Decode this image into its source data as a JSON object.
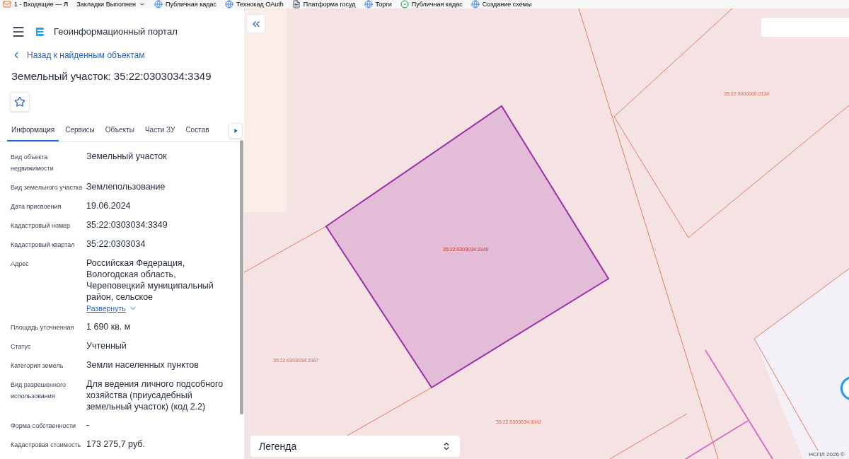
{
  "bookmarks": [
    {
      "kind": "mail",
      "label": "1 - Входящие — Я"
    },
    {
      "kind": "folder",
      "label": "Закладки Выполнен"
    },
    {
      "kind": "site",
      "label": "Публичная кадас"
    },
    {
      "kind": "site",
      "label": "Технокад OAuth"
    },
    {
      "kind": "page",
      "label": "Платформа госуд"
    },
    {
      "kind": "site",
      "label": "Торги"
    },
    {
      "kind": "check",
      "label": "Публичная кадас"
    },
    {
      "kind": "site",
      "label": "Создание схемы"
    }
  ],
  "header": {
    "title": "Геоинформационный портал"
  },
  "back_link": "Назад к найденным объектам",
  "object_title": "Земельный участок: 35:22:0303034:3349",
  "tabs": [
    {
      "label": "Информация",
      "selected": true
    },
    {
      "label": "Сервисы",
      "selected": false
    },
    {
      "label": "Объекты",
      "selected": false
    },
    {
      "label": "Части ЗУ",
      "selected": false
    },
    {
      "label": "Состав",
      "selected": false
    }
  ],
  "fields": [
    {
      "label": "Вид объекта недвижимости",
      "value": "Земельный участок"
    },
    {
      "label": "Вид земельного участка",
      "value": "Землепользование"
    },
    {
      "label": "Дата присвоения",
      "value": "19.06.2024"
    },
    {
      "label": "Кадастровый номер",
      "value": "35:22:0303034:3349"
    },
    {
      "label": "Кадастровый квартал",
      "value": "35:22:0303034"
    },
    {
      "label": "Адрес",
      "value": "Российская Федерация, Вологодская область, Череповецкий муниципальный район, сельское",
      "expand_link": "Развернуть"
    },
    {
      "label": "Площадь уточненная",
      "value": "1 690 кв. м"
    },
    {
      "label": "Статус",
      "value": "Учтенный"
    },
    {
      "label": "Категория земель",
      "value": "Земли населенных пунктов"
    },
    {
      "label": "Вид разрешенного использования",
      "value": "Для ведения личного подсобного хозяйства (приусадебный земельный участок) (код 2.2)"
    },
    {
      "label": "Форма собственности",
      "value": "-"
    },
    {
      "label": "Кадастровая стоимость",
      "value": "173 275,7 руб."
    }
  ],
  "map": {
    "parcel_labels": [
      {
        "label": "35:22:0000000:2134",
        "selected": false
      },
      {
        "label": "35:22:0303034:3349",
        "selected": true
      },
      {
        "label": "35:22:0303034:2087",
        "selected": false
      },
      {
        "label": "35:22:0303034:3342",
        "selected": false
      }
    ],
    "legend": {
      "label": "Легенда"
    },
    "attribution": "НСПЛ 2026 ©"
  }
}
